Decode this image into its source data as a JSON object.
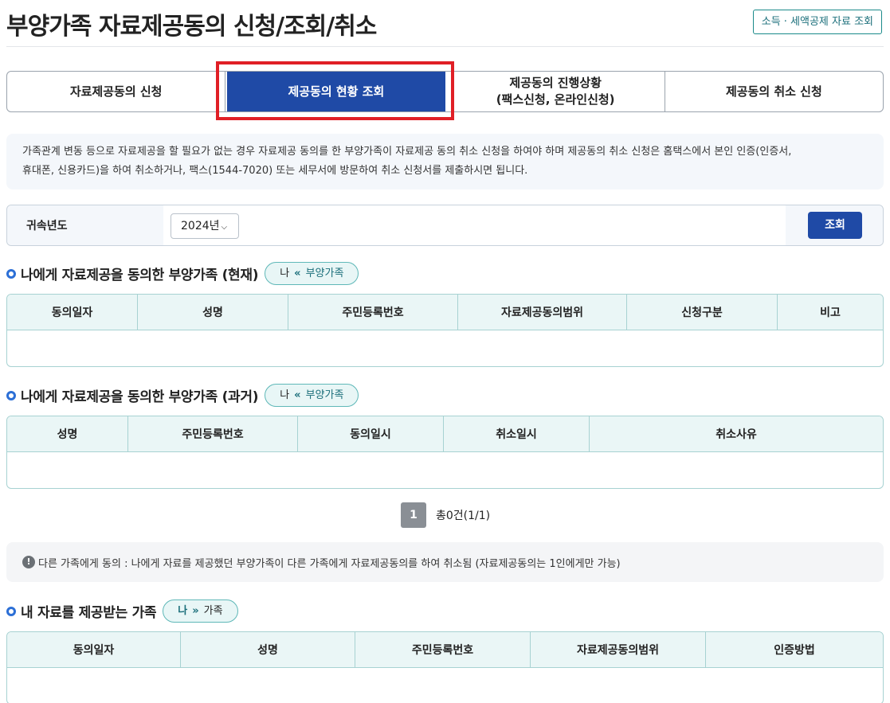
{
  "page": {
    "title": "부양가족 자료제공동의 신청/조회/취소",
    "top_link": "소득 · 세액공제 자료 조회"
  },
  "tabs": [
    {
      "label": "자료제공동의 신청",
      "active": false
    },
    {
      "label": "제공동의 현황 조회",
      "active": true
    },
    {
      "label": "제공동의 진행상황\n(팩스신청, 온라인신청)",
      "active": false
    },
    {
      "label": "제공동의 취소 신청",
      "active": false
    }
  ],
  "info": {
    "line1": "가족관계 변동 등으로 자료제공을 할 필요가 없는 경우 자료제공 동의를 한 부양가족이 자료제공 동의 취소 신청을 하여야 하며 제공동의 취소 신청은 홈택스에서 본인 인증(인증서,",
    "line2": "휴대폰, 신용카드)을 하여 취소하거나, 팩스(1544-7020) 또는 세무서에 방문하여 취소 신청서를 제출하시면 됩니다."
  },
  "filter": {
    "label": "귀속년도",
    "year_value": "2024년",
    "search_button": "조회"
  },
  "section_current": {
    "title": "나에게 자료제공을 동의한 부양가족 (현재)",
    "pill": {
      "me": "나",
      "arrow": "«",
      "family": "부양가족"
    },
    "columns": [
      "동의일자",
      "성명",
      "주민등록번호",
      "자료제공동의범위",
      "신청구분",
      "비고"
    ]
  },
  "section_past": {
    "title": "나에게 자료제공을 동의한 부양가족 (과거)",
    "pill": {
      "me": "나",
      "arrow": "«",
      "family": "부양가족"
    },
    "columns": [
      "성명",
      "주민등록번호",
      "동의일시",
      "취소일시",
      "취소사유"
    ]
  },
  "pagination": {
    "page": "1",
    "total": "총0건(1/1)"
  },
  "notice": {
    "icon": "!",
    "text": "다른 가족에게 동의 : 나에게 자료를 제공했던 부양가족이 다른 가족에게 자료제공동의를 하여 취소됨 (자료제공동의는 1인에게만 가능)"
  },
  "section_provided": {
    "title": "내 자료를 제공받는 가족",
    "pill": {
      "me": "나",
      "arrow": "»",
      "family": "가족"
    },
    "columns": [
      "동의일자",
      "성명",
      "주민등록번호",
      "자료제공동의범위",
      "인증방법"
    ]
  },
  "colors": {
    "primary": "#1f4aa6",
    "teal": "#1a6e7a",
    "highlight": "#e01f26",
    "table_header_bg": "#eaf6f6"
  }
}
